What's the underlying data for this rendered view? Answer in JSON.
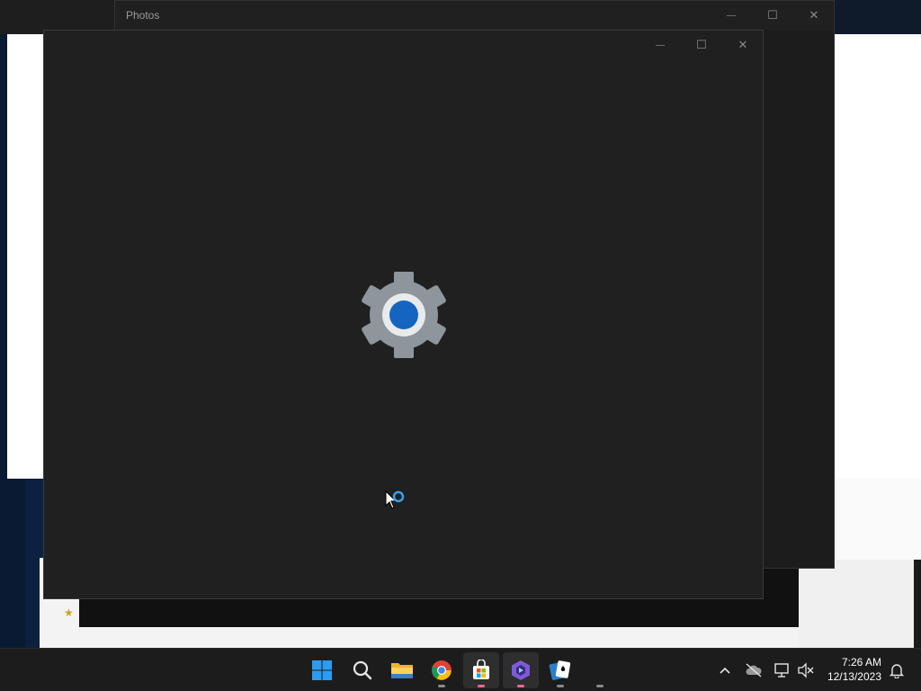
{
  "photos_window": {
    "title": "Photos",
    "minimize_glyph": "—",
    "maximize_glyph": "☐",
    "close_glyph": "✕"
  },
  "main_window": {
    "minimize_glyph": "—",
    "maximize_glyph": "☐",
    "close_glyph": "✕",
    "splash_icon": "settings-gear-icon"
  },
  "taskbar": {
    "apps": [
      {
        "name": "start",
        "icon": "windows-logo-icon"
      },
      {
        "name": "search",
        "icon": "search-icon"
      },
      {
        "name": "file-explorer",
        "icon": "folder-icon"
      },
      {
        "name": "chrome",
        "icon": "chrome-icon"
      },
      {
        "name": "store",
        "icon": "store-icon"
      },
      {
        "name": "clipchamp",
        "icon": "clipchamp-icon"
      },
      {
        "name": "solitaire",
        "icon": "solitaire-icon"
      }
    ],
    "tray": {
      "chevron": "^",
      "time": "7:26 AM",
      "date": "12/13/2023"
    }
  },
  "colors": {
    "accent_blue": "#1565c0",
    "gear_gray": "#8e959c",
    "taskbar_bg": "#1c1c1c",
    "window_bg": "#202020"
  }
}
